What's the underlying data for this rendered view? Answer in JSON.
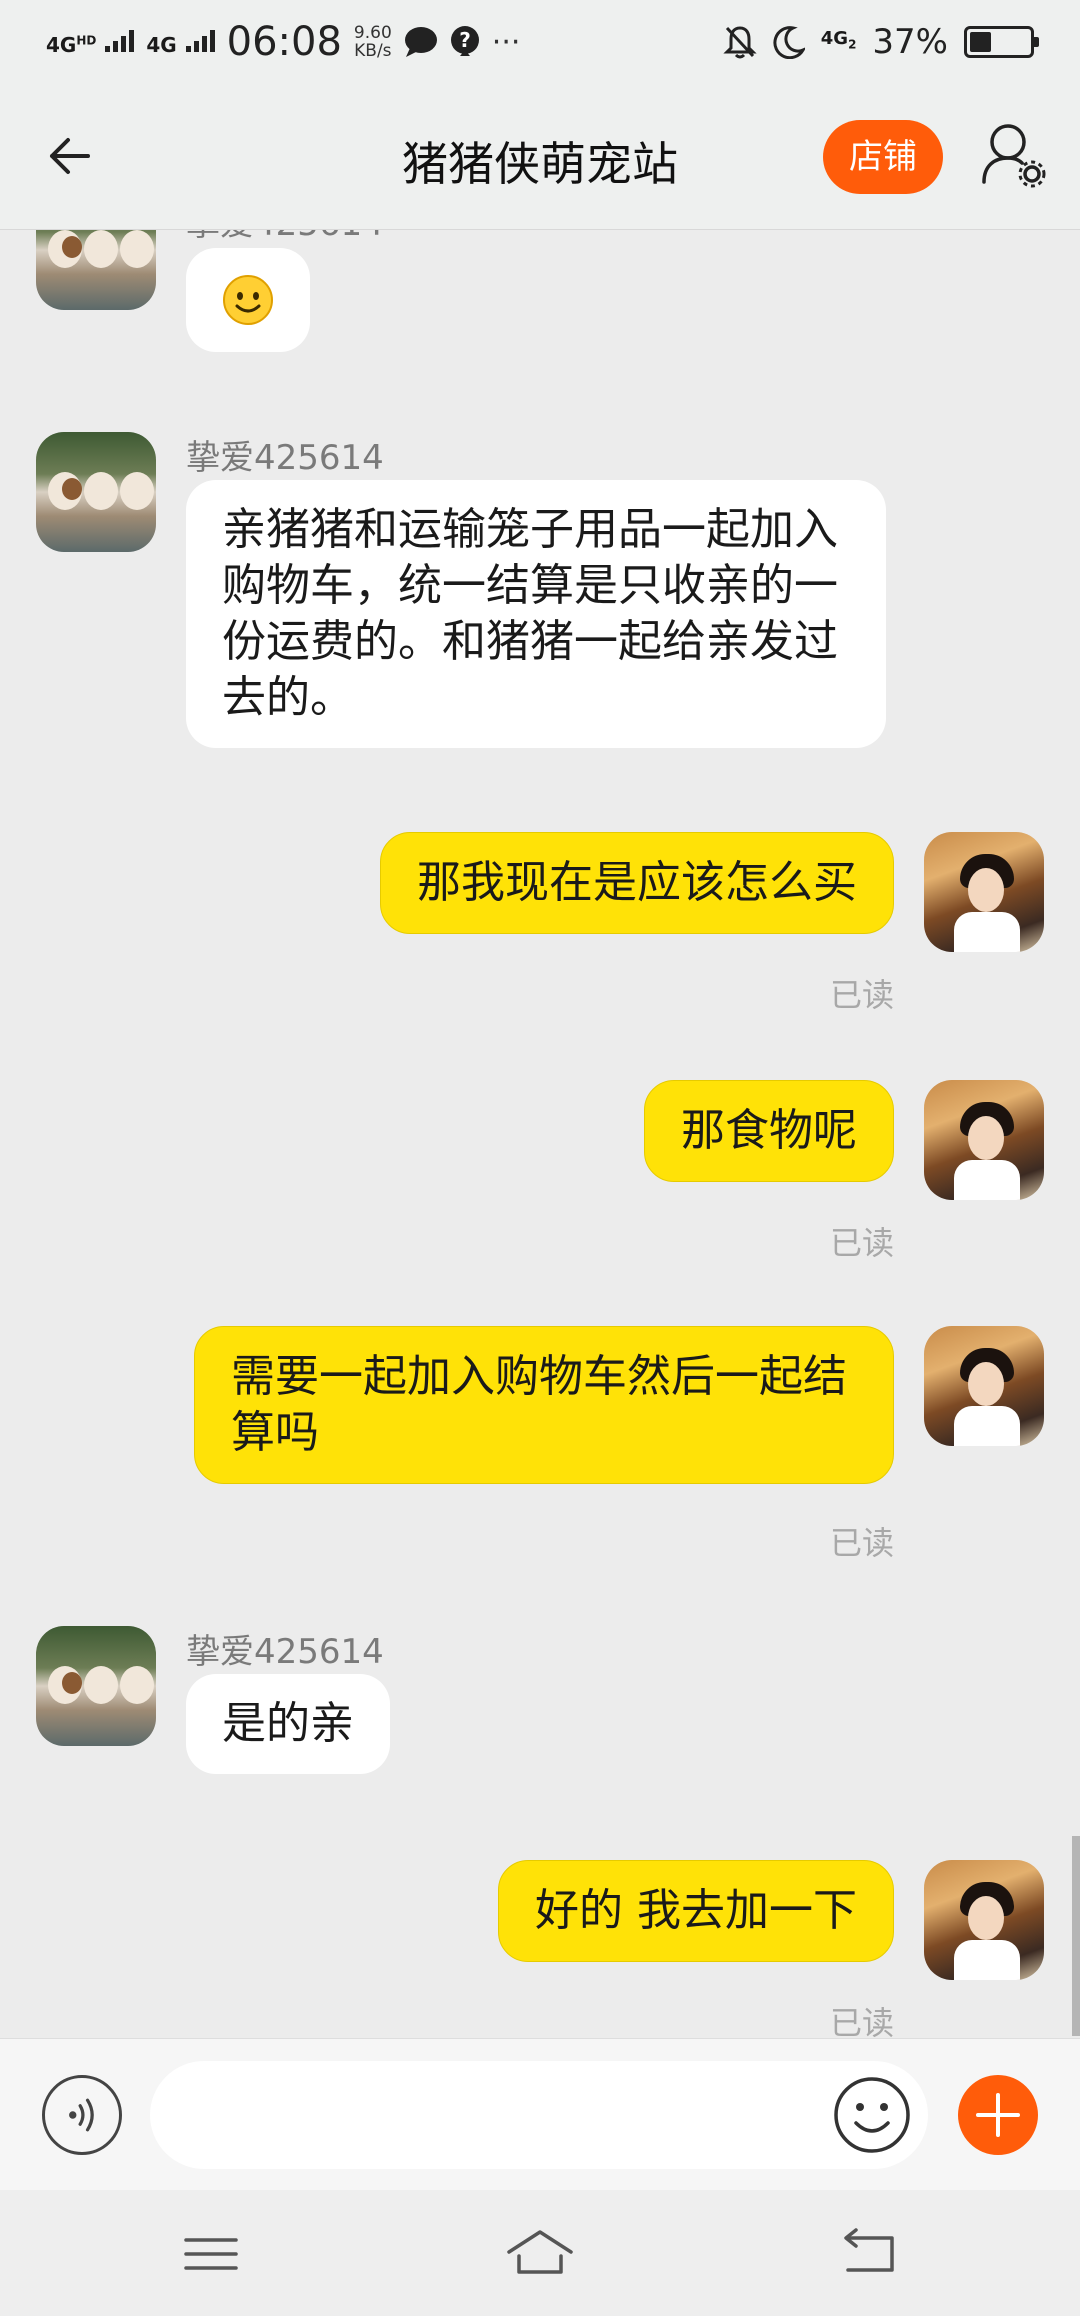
{
  "status_bar": {
    "network1": "4G",
    "network1_sup": "HD",
    "network2": "4G",
    "time": "06:08",
    "speed_value": "9.60",
    "speed_unit": "KB/s",
    "more": "···",
    "sim_label": "4G",
    "sim_sub": "2",
    "battery_text": "37%",
    "battery_level": 0.37
  },
  "header": {
    "title": "猪猪侠萌宠站",
    "shop_button": "店铺"
  },
  "messages": [
    {
      "side": "in",
      "sender": "挚爱425614",
      "text": "",
      "emoji": "smiley"
    },
    {
      "side": "in",
      "sender": "挚爱425614",
      "text": "亲猪猪和运输笼子用品一起加入购物车，统一结算是只收亲的一份运费的。和猪猪一起给亲发过去的。"
    },
    {
      "side": "out",
      "text": "那我现在是应该怎么买",
      "status": "已读"
    },
    {
      "side": "out",
      "text": "那食物呢",
      "status": "已读"
    },
    {
      "side": "out",
      "text": "需要一起加入购物车然后一起结算吗",
      "status": "已读"
    },
    {
      "side": "in",
      "sender": "挚爱425614",
      "text": "是的亲"
    },
    {
      "side": "out",
      "text": "好的 我去加一下",
      "status": "已读"
    }
  ],
  "input": {
    "value": "",
    "placeholder": ""
  },
  "colors": {
    "accent": "#ff5c0a",
    "outgoing_bubble": "#ffe207",
    "incoming_bubble": "#ffffff",
    "background": "#ececec"
  },
  "icons": {
    "back": "arrow-left-icon",
    "user_settings": "user-gear-icon",
    "voice": "voice-icon",
    "emoji": "smiley-icon",
    "plus": "plus-icon",
    "nav_menu": "menu-icon",
    "nav_home": "home-icon",
    "nav_back": "return-icon"
  }
}
